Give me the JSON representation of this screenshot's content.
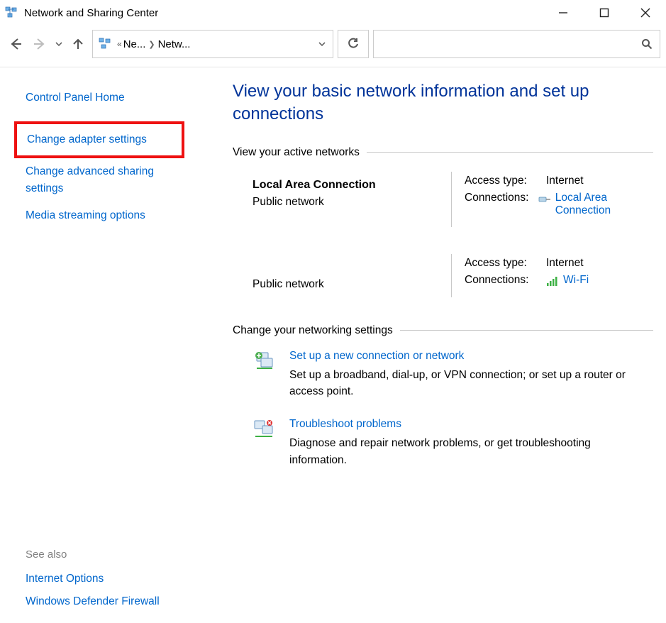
{
  "window": {
    "title": "Network and Sharing Center"
  },
  "addressbar": {
    "crumb1": "Ne...",
    "crumb2": "Netw..."
  },
  "search": {
    "placeholder": ""
  },
  "sidebar": {
    "items": {
      "home": "Control Panel Home",
      "adapter": "Change adapter settings",
      "advanced": "Change advanced sharing settings",
      "media": "Media streaming options"
    },
    "see_also_label": "See also",
    "see_also": {
      "internet_options": "Internet Options",
      "firewall": "Windows Defender Firewall"
    }
  },
  "main": {
    "title": "View your basic network information and set up connections",
    "section_active": "View your active networks",
    "section_change": "Change your networking settings",
    "networks": [
      {
        "name": "Local Area Connection",
        "type": "Public network",
        "access_label": "Access type:",
        "access_value": "Internet",
        "conn_label": "Connections:",
        "conn_link": "Local Area Connection",
        "conn_kind": "ethernet"
      },
      {
        "name": "",
        "type": "Public network",
        "access_label": "Access type:",
        "access_value": "Internet",
        "conn_label": "Connections:",
        "conn_link": "Wi-Fi",
        "conn_kind": "wifi"
      }
    ],
    "settings": [
      {
        "link": "Set up a new connection or network",
        "desc": "Set up a broadband, dial-up, or VPN connection; or set up a router or access point."
      },
      {
        "link": "Troubleshoot problems",
        "desc": "Diagnose and repair network problems, or get troubleshooting information."
      }
    ]
  }
}
